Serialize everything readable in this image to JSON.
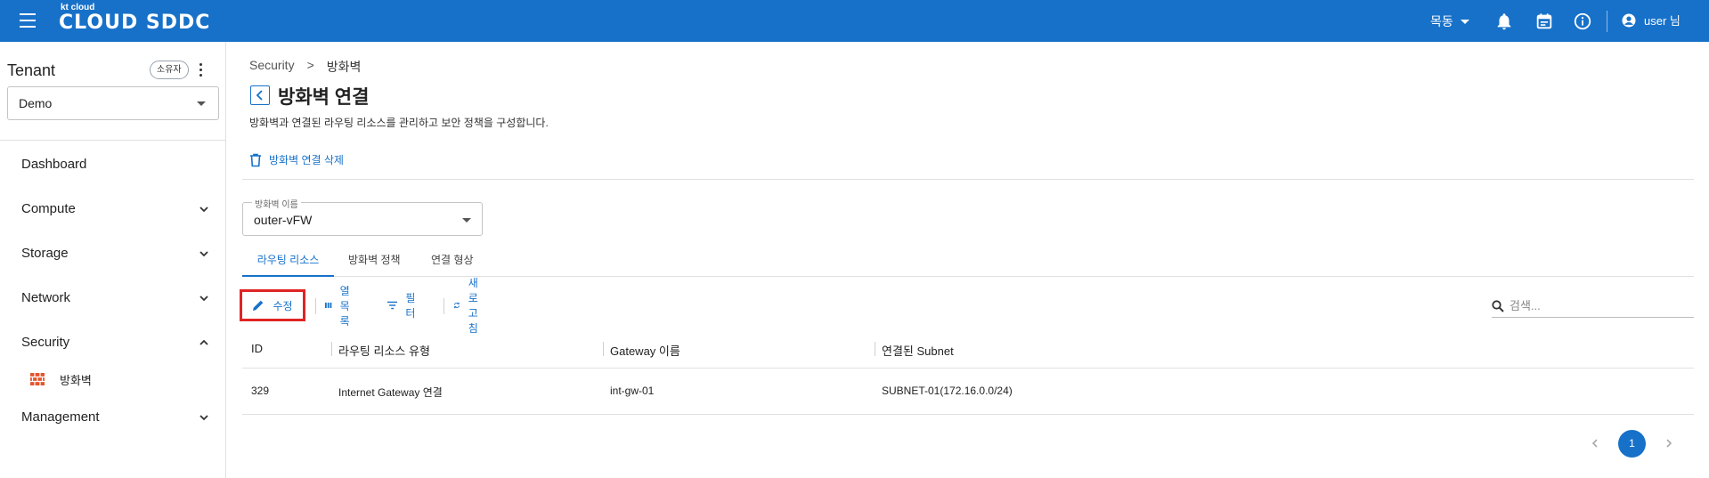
{
  "header": {
    "logo_small": "kt cloud",
    "logo_main": "CLOUD SDDC",
    "region": "목동",
    "user": "user 님",
    "icons": [
      "menu-icon",
      "bell-icon",
      "calendar-icon",
      "info-icon",
      "account-icon"
    ]
  },
  "sidebar": {
    "tenant_title": "Tenant",
    "owner_badge": "소유자",
    "tenant_value": "Demo",
    "items": [
      {
        "label": "Dashboard"
      },
      {
        "label": "Compute"
      },
      {
        "label": "Storage"
      },
      {
        "label": "Network"
      },
      {
        "label": "Security"
      },
      {
        "label": "Management"
      }
    ],
    "security_sub": {
      "label": "방화벽",
      "icon": "firewall-icon"
    }
  },
  "breadcrumb": {
    "parent": "Security",
    "separator": ">",
    "current": "방화벽"
  },
  "page": {
    "title": "방화벽 연결",
    "description": "방화벽과 연결된 라우팅 리소스를 관리하고 보안 정책을 구성합니다.",
    "delete_label": "방화벽 연결 삭제"
  },
  "firewall_select": {
    "label": "방화벽 이름",
    "value": "outer-vFW"
  },
  "tabs": [
    {
      "label": "라우팅 리소스",
      "active": true
    },
    {
      "label": "방화벽 정책",
      "active": false
    },
    {
      "label": "연결 형상",
      "active": false
    }
  ],
  "toolbar": {
    "edit": "수정",
    "columns": "열 목록",
    "filter": "필터",
    "refresh": "새로고침",
    "search_placeholder": "검색..."
  },
  "table": {
    "columns": [
      "ID",
      "라우팅 리소스 유형",
      "Gateway 이름",
      "연결된 Subnet"
    ],
    "rows": [
      [
        "329",
        "Internet Gateway 연결",
        "int-gw-01",
        "SUBNET-01(172.16.0.0/24)"
      ]
    ]
  },
  "pagination": {
    "current": "1"
  },
  "colors": {
    "primary": "#1771c9",
    "highlight": "#e02424",
    "firewall_icon": "#e4552d"
  }
}
